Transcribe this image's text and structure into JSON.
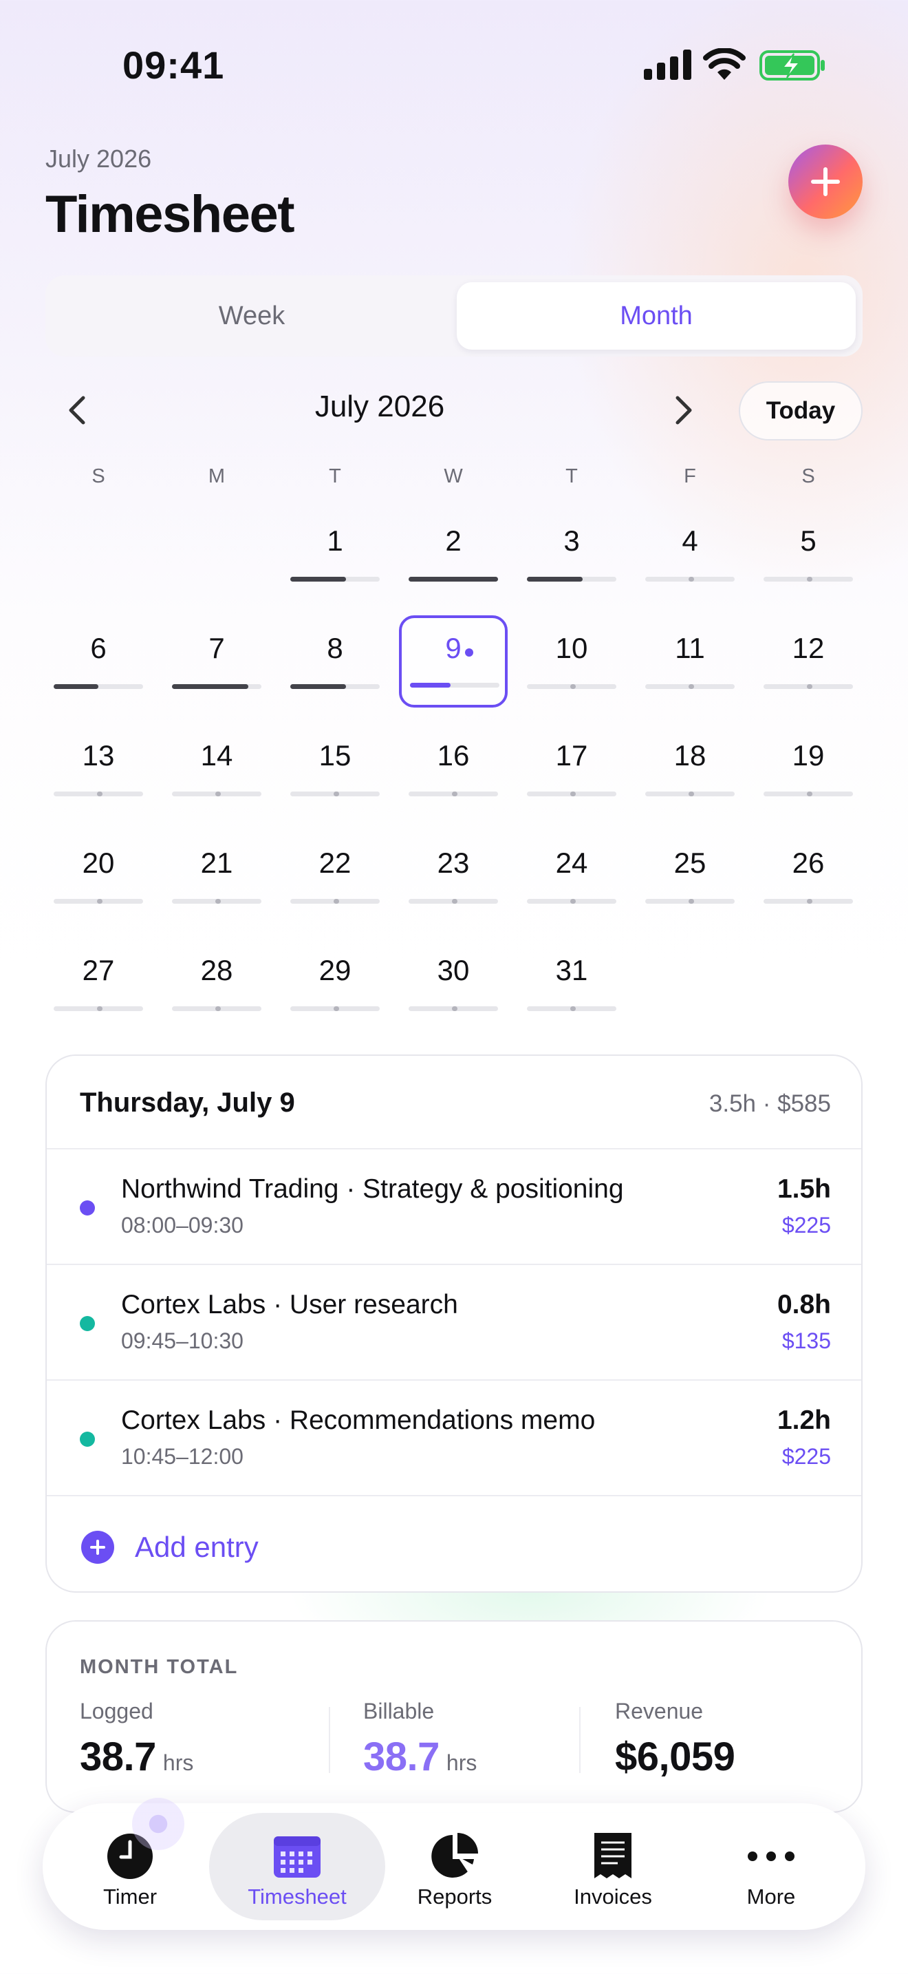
{
  "status_bar": {
    "time": "09:41"
  },
  "header": {
    "subtitle": "July 2026",
    "title": "Timesheet"
  },
  "view_toggle": {
    "options": [
      "Week",
      "Month"
    ],
    "selected": "Month"
  },
  "calendar": {
    "month_label": "July 2026",
    "today_label": "Today",
    "weekdays": [
      "S",
      "M",
      "T",
      "W",
      "T",
      "F",
      "S"
    ],
    "selected_day": "9",
    "weeks": [
      [
        "",
        "",
        "1",
        "2",
        "3",
        "4",
        "5"
      ],
      [
        "6",
        "7",
        "8",
        "9",
        "10",
        "11",
        "12"
      ],
      [
        "13",
        "14",
        "15",
        "16",
        "17",
        "18",
        "19"
      ],
      [
        "20",
        "21",
        "22",
        "23",
        "24",
        "25",
        "26"
      ],
      [
        "27",
        "28",
        "29",
        "30",
        "31",
        "",
        ""
      ]
    ],
    "day_progress": {
      "1": 0.62,
      "2": 1.0,
      "3": 0.62,
      "6": 0.5,
      "7": 0.85,
      "8": 0.62,
      "9": 0.45
    }
  },
  "day_detail": {
    "title": "Thursday, July 9",
    "summary": "3.5h · $585",
    "entries": [
      {
        "title": "Northwind Trading · Strategy & positioning",
        "time": "08:00–09:30",
        "hours": "1.5h",
        "amount": "$225",
        "color": "#6b4ef3"
      },
      {
        "title": "Cortex Labs · User research",
        "time": "09:45–10:30",
        "hours": "0.8h",
        "amount": "$135",
        "color": "#14b8a0"
      },
      {
        "title": "Cortex Labs · Recommendations memo",
        "time": "10:45–12:00",
        "hours": "1.2h",
        "amount": "$225",
        "color": "#14b8a0"
      }
    ],
    "add_entry_label": "Add entry"
  },
  "month_total": {
    "label": "MONTH TOTAL",
    "stats": [
      {
        "label": "Logged",
        "value": "38.7",
        "unit": "hrs"
      },
      {
        "label": "Billable",
        "value": "38.7",
        "unit": "hrs"
      },
      {
        "label": "Revenue",
        "value": "$6,059",
        "unit": ""
      }
    ]
  },
  "tab_bar": {
    "tabs": [
      {
        "label": "Timer",
        "icon": "clock-icon"
      },
      {
        "label": "Timesheet",
        "icon": "calendar-icon"
      },
      {
        "label": "Reports",
        "icon": "pie-chart-icon"
      },
      {
        "label": "Invoices",
        "icon": "receipt-icon"
      },
      {
        "label": "More",
        "icon": "more-icon"
      }
    ],
    "active": "Timesheet"
  },
  "colors": {
    "accent": "#6b4ef3",
    "teal": "#14b8a0",
    "battery": "#34c759"
  }
}
